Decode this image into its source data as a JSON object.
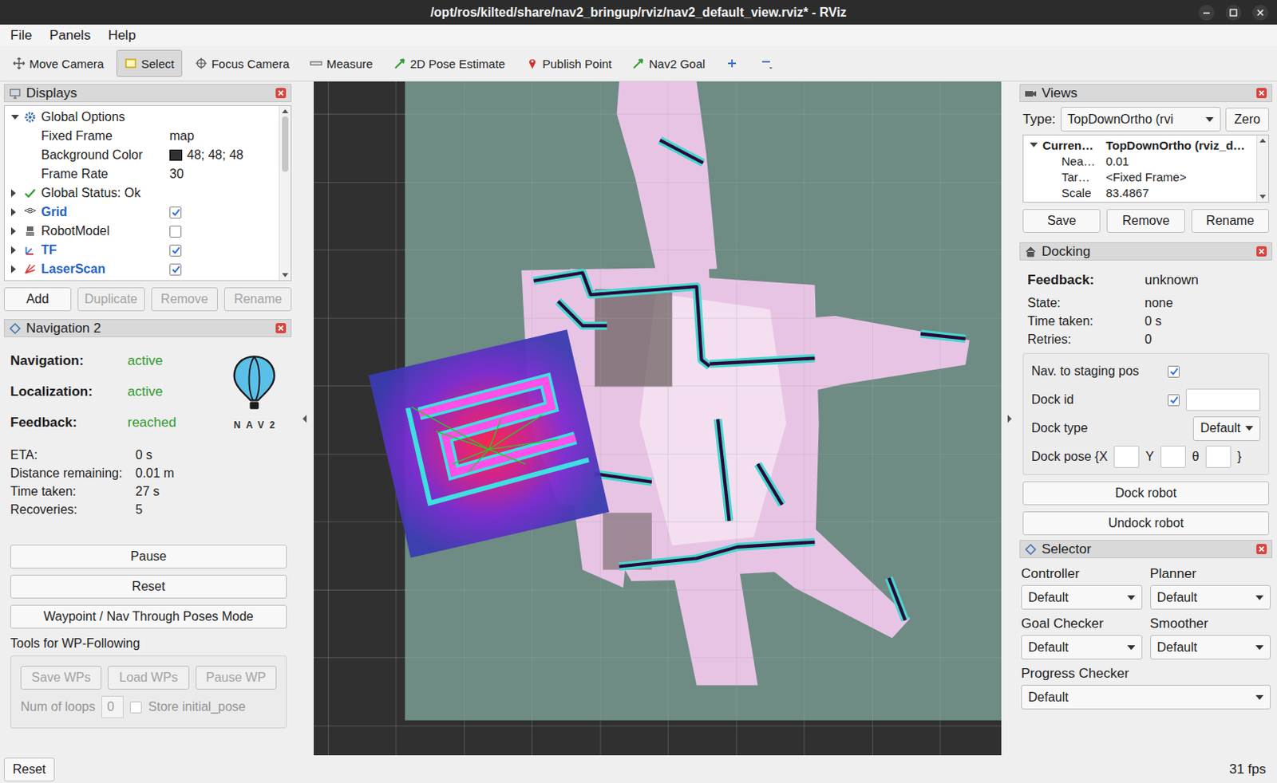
{
  "window": {
    "title": "/opt/ros/kilted/share/nav2_bringup/rviz/nav2_default_view.rviz* - RViz"
  },
  "menu": [
    {
      "label": "File"
    },
    {
      "label": "Panels"
    },
    {
      "label": "Help"
    }
  ],
  "toolbar": [
    {
      "label": "Move Camera",
      "selected": false
    },
    {
      "label": "Select",
      "selected": true
    },
    {
      "label": "Focus Camera",
      "selected": false
    },
    {
      "label": "Measure",
      "selected": false
    },
    {
      "label": "2D Pose Estimate",
      "selected": false
    },
    {
      "label": "Publish Point",
      "selected": false
    },
    {
      "label": "Nav2 Goal",
      "selected": false
    }
  ],
  "displays": {
    "title": "Displays",
    "rows": [
      {
        "kind": "group",
        "label": "Global Options",
        "value": "",
        "expanded": true
      },
      {
        "kind": "property",
        "label": "Fixed Frame",
        "value": "map"
      },
      {
        "kind": "color",
        "label": "Background Color",
        "value": "48; 48; 48",
        "color": "#303030"
      },
      {
        "kind": "property",
        "label": "Frame Rate",
        "value": "30"
      },
      {
        "kind": "status",
        "label": "Global Status: Ok",
        "value": "",
        "expanded": false
      },
      {
        "kind": "display",
        "label": "Grid",
        "value": "",
        "expanded": false,
        "checked": true
      },
      {
        "kind": "display",
        "label": "RobotModel",
        "value": "",
        "expanded": false,
        "checked": false
      },
      {
        "kind": "display",
        "label": "TF",
        "value": "",
        "expanded": false,
        "checked": true
      },
      {
        "kind": "display",
        "label": "LaserScan",
        "value": "",
        "expanded": false,
        "checked": true
      }
    ],
    "buttons": [
      {
        "label": "Add",
        "disabled": false
      },
      {
        "label": "Duplicate",
        "disabled": true
      },
      {
        "label": "Remove",
        "disabled": true
      },
      {
        "label": "Rename",
        "disabled": true
      }
    ]
  },
  "nav2": {
    "title": "Navigation 2",
    "status": [
      {
        "label": "Navigation:",
        "value": "active"
      },
      {
        "label": "Localization:",
        "value": "active"
      },
      {
        "label": "Feedback:",
        "value": "reached"
      }
    ],
    "logo": "NAV2",
    "metrics": [
      {
        "label": "ETA:",
        "value": "0 s"
      },
      {
        "label": "Distance remaining:",
        "value": "0.01 m"
      },
      {
        "label": "Time taken:",
        "value": "27 s"
      },
      {
        "label": "Recoveries:",
        "value": "5"
      }
    ],
    "buttons": [
      {
        "label": "Pause"
      },
      {
        "label": "Reset"
      },
      {
        "label": "Waypoint / Nav Through Poses Mode"
      }
    ],
    "wp": {
      "title": "Tools for WP-Following",
      "buttons": [
        {
          "label": "Save WPs",
          "disabled": true
        },
        {
          "label": "Load WPs",
          "disabled": true
        },
        {
          "label": "Pause WP",
          "disabled": true
        }
      ],
      "loops": {
        "label": "Num of loops",
        "value": "0",
        "disabled": true
      },
      "store": {
        "label": "Store initial_pose",
        "checked": false,
        "disabled": true
      }
    }
  },
  "views": {
    "title": "Views",
    "type_label": "Type:",
    "type_value": "TopDownOrtho (rvi",
    "zero": "Zero",
    "rows": [
      {
        "kind": "header",
        "name": "Curren…",
        "value": "TopDownOrtho (rviz_d…",
        "expanded": true
      },
      {
        "kind": "property",
        "name": "Nea…",
        "value": "0.01"
      },
      {
        "kind": "property",
        "name": "Tar…",
        "value": "<Fixed Frame>"
      },
      {
        "kind": "property",
        "name": "Scale",
        "value": "83.4867"
      }
    ],
    "buttons": [
      {
        "label": "Save"
      },
      {
        "label": "Remove"
      },
      {
        "label": "Rename"
      }
    ]
  },
  "docking": {
    "title": "Docking",
    "info": [
      {
        "kind": "header",
        "label": "Feedback:",
        "value": "unknown"
      },
      {
        "kind": "plain",
        "label": "State:",
        "value": "none"
      },
      {
        "kind": "plain",
        "label": "Time taken:",
        "value": "0 s"
      },
      {
        "kind": "plain",
        "label": "Retries:",
        "value": "0"
      }
    ],
    "staging": {
      "label": "Nav. to staging pos",
      "checked": true
    },
    "dock_id": {
      "label": "Dock id",
      "checked": true,
      "value": ""
    },
    "dock_type": {
      "label": "Dock type",
      "value": "Default"
    },
    "dock_pose": {
      "label": "Dock pose {X",
      "fields": [
        {
          "label": "",
          "value": ""
        },
        {
          "label": "Y",
          "value": ""
        },
        {
          "label": "θ",
          "value": ""
        }
      ],
      "close": "}"
    },
    "buttons": [
      {
        "label": "Dock robot"
      },
      {
        "label": "Undock robot"
      }
    ]
  },
  "selector": {
    "title": "Selector",
    "items": [
      {
        "label": "Controller",
        "value": "Default"
      },
      {
        "label": "Planner",
        "value": "Default"
      },
      {
        "label": "Goal Checker",
        "value": "Default"
      },
      {
        "label": "Smoother",
        "value": "Default"
      },
      {
        "label": "Progress Checker",
        "value": "Default"
      }
    ]
  },
  "footer": {
    "reset": "Reset",
    "fps": "31 fps"
  }
}
